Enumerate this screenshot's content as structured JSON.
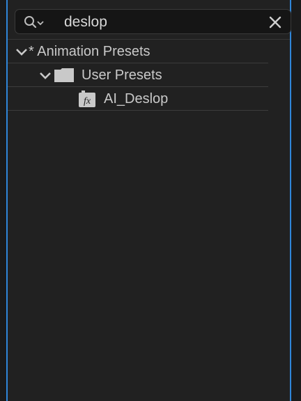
{
  "search": {
    "value": "deslop"
  },
  "tree": {
    "root": {
      "label": "* Animation Presets",
      "expanded": true
    },
    "folder": {
      "label": "User Presets",
      "expanded": true
    },
    "preset": {
      "label": "AI_Deslop",
      "icon": "fx-preset-icon",
      "icon_text": "fx"
    }
  },
  "colors": {
    "panel_bg": "#212121",
    "focus_border": "#2f86d9",
    "text": "#c9c9c9"
  }
}
